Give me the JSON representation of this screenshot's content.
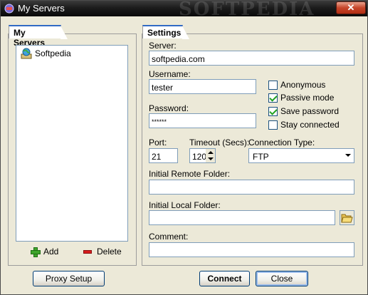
{
  "window": {
    "title": "My Servers",
    "watermark": "SOFTPEDIA",
    "close_glyph": "✕"
  },
  "servers_panel": {
    "tab_label": "My Servers",
    "items": [
      {
        "label": "Softpedia",
        "icon": "server-globe-icon"
      }
    ],
    "add_label": "Add",
    "delete_label": "Delete"
  },
  "settings": {
    "tab_label": "Settings",
    "server_label": "Server:",
    "server_value": "softpedia.com",
    "username_label": "Username:",
    "username_value": "tester",
    "password_label": "Password:",
    "password_value": "******",
    "options": [
      {
        "label": "Anonymous",
        "checked": false
      },
      {
        "label": "Passive mode",
        "checked": true
      },
      {
        "label": "Save password",
        "checked": true
      },
      {
        "label": "Stay connected",
        "checked": false
      }
    ],
    "port_label": "Port:",
    "port_value": "21",
    "timeout_label": "Timeout (Secs):",
    "timeout_value": "120",
    "connection_type_label": "Connection Type:",
    "connection_type_value": "FTP",
    "remote_folder_label": "Initial Remote Folder:",
    "remote_folder_value": "",
    "local_folder_label": "Initial Local Folder:",
    "local_folder_value": "",
    "comment_label": "Comment:",
    "comment_value": ""
  },
  "buttons": {
    "proxy_setup": "Proxy Setup",
    "connect": "Connect",
    "close": "Close"
  },
  "colors": {
    "titlebar": "#1c1c1c",
    "accent": "#316ac5",
    "window_bg": "#ece9d8"
  }
}
